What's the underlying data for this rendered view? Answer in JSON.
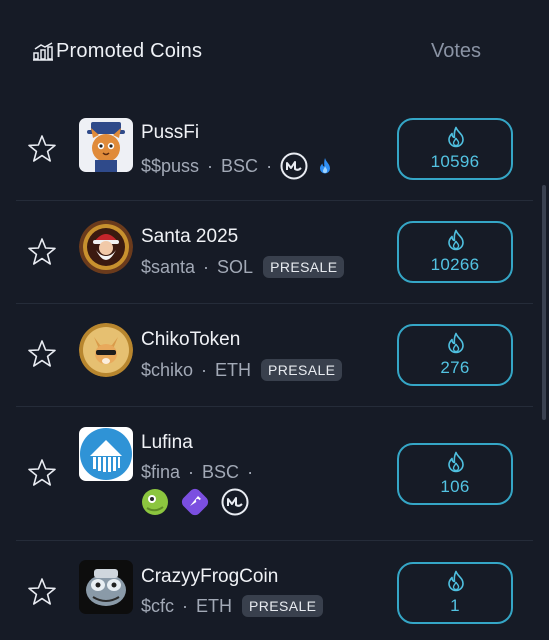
{
  "header": {
    "title": "Promoted Coins",
    "votes_label": "Votes"
  },
  "coins": [
    {
      "name": "PussFi",
      "ticker": "$$puss",
      "chain": "BSC",
      "votes": "10596"
    },
    {
      "name": "Santa 2025",
      "ticker": "$santa",
      "chain": "SOL",
      "badge": "PRESALE",
      "votes": "10266"
    },
    {
      "name": "ChikoToken",
      "ticker": "$chiko",
      "chain": "ETH",
      "badge": "PRESALE",
      "votes": "276"
    },
    {
      "name": "Lufina",
      "ticker": "$fina",
      "chain": "BSC",
      "votes": "106"
    },
    {
      "name": "CrazyyFrogCoin",
      "ticker": "$cfc",
      "chain": "ETH",
      "badge": "PRESALE",
      "votes": "1"
    }
  ],
  "separator": "·",
  "icons": {
    "header": "bar-chart-icon",
    "favorite": "star-outline-icon",
    "vote": "flame-icon",
    "coinmarketcap": "coinmarketcap-icon",
    "trending": "fire-icon",
    "coingecko": "coingecko-icon",
    "rocket": "purple-rocket-icon"
  },
  "colors": {
    "accent": "#35a6c6",
    "background": "#161b26",
    "badge_bg": "#39404d"
  }
}
